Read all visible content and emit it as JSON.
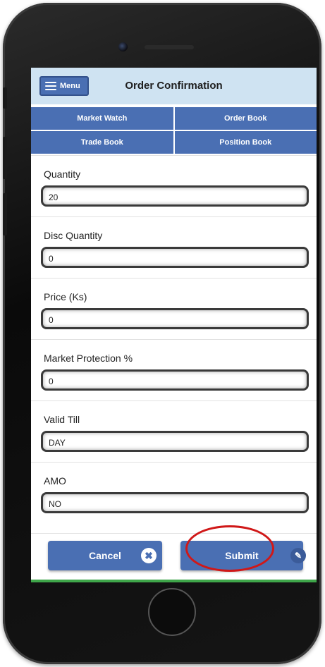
{
  "header": {
    "menu_label": "Menu",
    "title": "Order Confirmation"
  },
  "nav": {
    "items": [
      "Market Watch",
      "Order Book",
      "Trade Book",
      "Position Book"
    ]
  },
  "form": {
    "fields": [
      {
        "label": "Quantity",
        "value": "20"
      },
      {
        "label": "Disc Quantity",
        "value": "0"
      },
      {
        "label": "Price (Ks)",
        "value": "0"
      },
      {
        "label": "Market Protection %",
        "value": "0"
      },
      {
        "label": "Valid Till",
        "value": "DAY"
      },
      {
        "label": "AMO",
        "value": "NO"
      }
    ]
  },
  "actions": {
    "cancel_label": "Cancel",
    "submit_label": "Submit"
  },
  "icons": {
    "menu": "hamburger-icon",
    "cancel": "close-icon",
    "submit": "pencil-icon"
  },
  "colors": {
    "primary": "#4a6fb3",
    "header_bg": "#cfe3f2",
    "highlight": "#d01818"
  }
}
